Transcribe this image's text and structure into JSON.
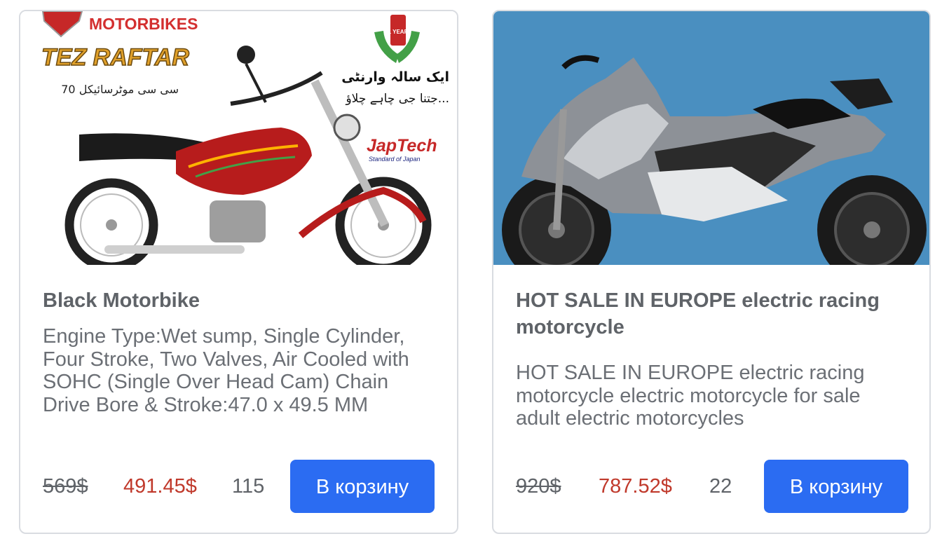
{
  "products": [
    {
      "image_banner": {
        "brand": "MOTORBIKES",
        "model": "TEZ RAFTAR",
        "subtitle": "70 سی سی موٹرسائیکل",
        "warranty_badge": "1 YEAR",
        "warranty_line1": "ایک سالہ وارنٹی",
        "warranty_line2": "جتنا جی چاہے چلاؤ...",
        "japtech": "JapTech",
        "japtech_sub": "Standard of Japan"
      },
      "title": "Black Motorbike",
      "description": "Engine Type:Wet sump, Single Cylinder, Four Stroke, Two Valves, Air Cooled with SOHC (Single Over Head Cam) Chain Drive Bore & Stroke:47.0 x 49.5 MM",
      "old_price": "569$",
      "price": "491.45$",
      "quantity": "115",
      "button": "В корзину"
    },
    {
      "title": "HOT SALE IN EUROPE electric racing motorcycle",
      "description": "HOT SALE IN EUROPE electric racing motorcycle electric motorcycle for sale adult electric motorcycles",
      "old_price": "920$",
      "price": "787.52$",
      "quantity": "22",
      "button": "В корзину"
    }
  ],
  "colors": {
    "accent": "#2b6cf2",
    "sale_price": "#c0392b",
    "image2_bg": "#4a8fc0"
  }
}
